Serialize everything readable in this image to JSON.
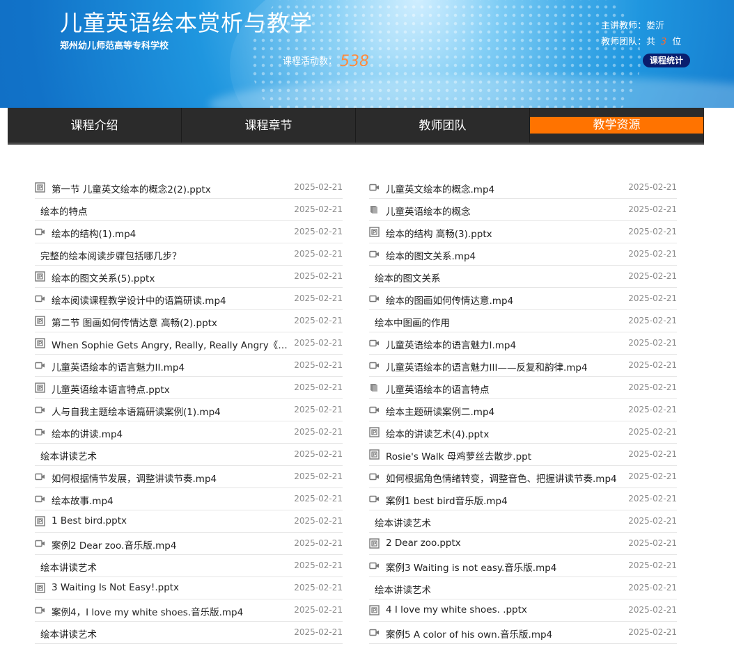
{
  "header": {
    "title": "儿童英语绘本赏析与教学",
    "school": "郑州幼儿师范高等专科学校",
    "activity_label": "课程活动数：",
    "activity_count": "538",
    "teacher": "主讲教师：娄沂",
    "team_prefix": "教师团队：共",
    "team_count": "3",
    "team_suffix": "位",
    "stats_button": "课程统计"
  },
  "nav": {
    "tabs": [
      {
        "label": "课程介绍"
      },
      {
        "label": "课程章节"
      },
      {
        "label": "教师团队"
      },
      {
        "label": "教学资源",
        "active": true
      }
    ]
  },
  "resources": {
    "left": [
      {
        "type": "pptx",
        "name": "第一节 儿童英文绘本的概念2(2).pptx",
        "date": "2025-02-21"
      },
      {
        "type": "none",
        "name": "绘本的特点",
        "date": "2025-02-21"
      },
      {
        "type": "video",
        "name": "绘本的结构(1).mp4",
        "date": "2025-02-21"
      },
      {
        "type": "none",
        "name": "完整的绘本阅读步骤包括哪几步？",
        "date": "2025-02-21"
      },
      {
        "type": "pptx",
        "name": "绘本的图文关系(5).pptx",
        "date": "2025-02-21"
      },
      {
        "type": "video",
        "name": "绘本阅读课程教学设计中的语篇研读.mp4",
        "date": "2025-02-21"
      },
      {
        "type": "pptx",
        "name": "第二节 图画如何传情达意 高畅(2).pptx",
        "date": "2025-02-21"
      },
      {
        "type": "pptx",
        "name": "When Sophie Gets Angry, Really, Really Angry《非...",
        "date": "2025-02-21"
      },
      {
        "type": "video",
        "name": "儿童英语绘本的语言魅力II.mp4",
        "date": "2025-02-21"
      },
      {
        "type": "pptx",
        "name": "儿童英语绘本语言特点.pptx",
        "date": "2025-02-21"
      },
      {
        "type": "video",
        "name": "人与自我主题绘本语篇研读案例(1).mp4",
        "date": "2025-02-21"
      },
      {
        "type": "video",
        "name": "绘本的讲读.mp4",
        "date": "2025-02-21"
      },
      {
        "type": "none",
        "name": "绘本讲读艺术",
        "date": "2025-02-21"
      },
      {
        "type": "video",
        "name": "如何根据情节发展，调整讲读节奏.mp4",
        "date": "2025-02-21"
      },
      {
        "type": "video",
        "name": "绘本故事.mp4",
        "date": "2025-02-21"
      },
      {
        "type": "pptx",
        "name": "1 Best bird.pptx",
        "date": "2025-02-21"
      },
      {
        "type": "video",
        "name": "案例2 Dear zoo.音乐版.mp4",
        "date": "2025-02-21"
      },
      {
        "type": "none",
        "name": "绘本讲读艺术",
        "date": "2025-02-21"
      },
      {
        "type": "pptx",
        "name": "3 Waiting Is Not Easy!.pptx",
        "date": "2025-02-21"
      },
      {
        "type": "video",
        "name": "案例4，I love my white shoes.音乐版.mp4",
        "date": "2025-02-21"
      },
      {
        "type": "none",
        "name": "绘本讲读艺术",
        "date": "2025-02-21"
      }
    ],
    "right": [
      {
        "type": "video",
        "name": "儿童英文绘本的概念.mp4",
        "date": "2025-02-21"
      },
      {
        "type": "book",
        "name": "儿童英语绘本的概念",
        "date": "2025-02-21"
      },
      {
        "type": "pptx",
        "name": "绘本的结构 高畅(3).pptx",
        "date": "2025-02-21"
      },
      {
        "type": "video",
        "name": "绘本的图文关系.mp4",
        "date": "2025-02-21"
      },
      {
        "type": "none",
        "name": "绘本的图文关系",
        "date": "2025-02-21"
      },
      {
        "type": "video",
        "name": "绘本的图画如何传情达意.mp4",
        "date": "2025-02-21"
      },
      {
        "type": "none",
        "name": "绘本中图画的作用",
        "date": "2025-02-21"
      },
      {
        "type": "video",
        "name": "儿童英语绘本的语言魅力I.mp4",
        "date": "2025-02-21"
      },
      {
        "type": "video",
        "name": "儿童英语绘本的语言魅力III——反复和韵律.mp4",
        "date": "2025-02-21"
      },
      {
        "type": "book",
        "name": "儿童英语绘本的语言特点",
        "date": "2025-02-21"
      },
      {
        "type": "video",
        "name": "绘本主题研读案例二.mp4",
        "date": "2025-02-21"
      },
      {
        "type": "pptx",
        "name": "绘本的讲读艺术(4).pptx",
        "date": "2025-02-21"
      },
      {
        "type": "pptx",
        "name": "Rosie's Walk 母鸡萝丝去散步.ppt",
        "date": "2025-02-21"
      },
      {
        "type": "video",
        "name": "如何根据角色情绪转变，调整音色、把握讲读节奏.mp4",
        "date": "2025-02-21"
      },
      {
        "type": "video",
        "name": "案例1 best bird音乐版.mp4",
        "date": "2025-02-21"
      },
      {
        "type": "none",
        "name": "绘本讲读艺术",
        "date": "2025-02-21"
      },
      {
        "type": "pptx",
        "name": "2 Dear zoo.pptx",
        "date": "2025-02-21"
      },
      {
        "type": "video",
        "name": "案例3 Waiting is not easy.音乐版.mp4",
        "date": "2025-02-21"
      },
      {
        "type": "none",
        "name": "绘本讲读艺术",
        "date": "2025-02-21"
      },
      {
        "type": "pptx",
        "name": "4 I love my white shoes. .pptx",
        "date": "2025-02-21"
      },
      {
        "type": "video",
        "name": "案例5 A color of his own.音乐版.mp4",
        "date": "2025-02-21"
      }
    ]
  },
  "icons": {
    "pptx": "ppt-file-icon",
    "video": "video-camera-icon",
    "book": "book-icon"
  },
  "colors": {
    "accent": "#ff7300",
    "nav_bg": "#2b2b2b",
    "stats_button": "#0a1e6e"
  }
}
